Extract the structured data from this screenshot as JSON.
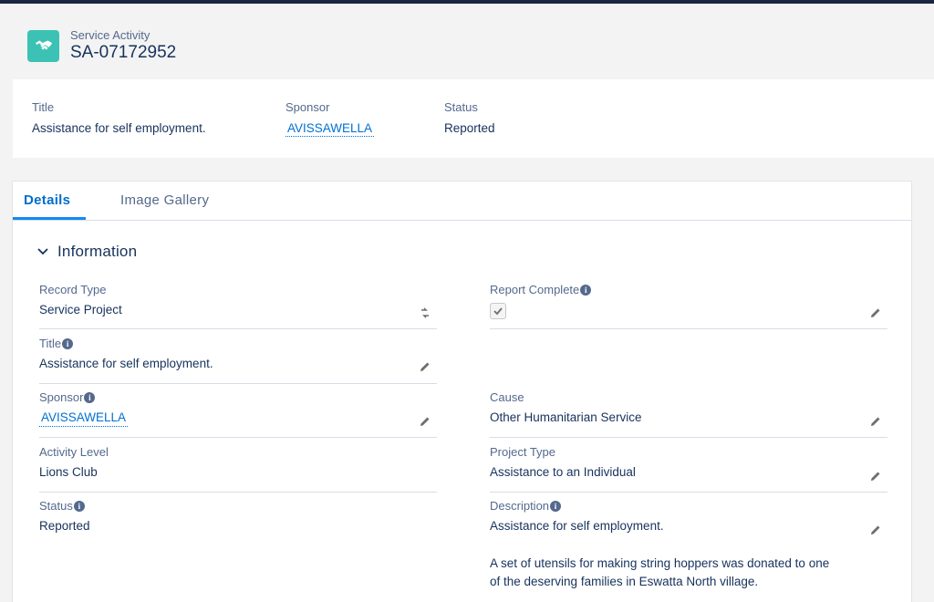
{
  "header": {
    "object_label": "Service Activity",
    "record_name": "SA-07172952",
    "icon": "handshake-icon",
    "icon_color": "#3bc2b4"
  },
  "highlights": {
    "title_label": "Title",
    "title_value": "Assistance for self employment.",
    "sponsor_label": "Sponsor",
    "sponsor_value": "AVISSAWELLA",
    "status_label": "Status",
    "status_value": "Reported"
  },
  "tabs": {
    "details": "Details",
    "gallery": "Image Gallery"
  },
  "section": {
    "title": "Information"
  },
  "fields": {
    "record_type": {
      "label": "Record Type",
      "value": "Service Project"
    },
    "title": {
      "label": "Title",
      "value": "Assistance for self employment."
    },
    "sponsor": {
      "label": "Sponsor",
      "value": "AVISSAWELLA"
    },
    "activity_level": {
      "label": "Activity Level",
      "value": "Lions Club"
    },
    "status": {
      "label": "Status",
      "value": "Reported"
    },
    "report_complete": {
      "label": "Report Complete",
      "checked": true
    },
    "cause": {
      "label": "Cause",
      "value": "Other Humanitarian Service"
    },
    "project_type": {
      "label": "Project Type",
      "value": "Assistance to an Individual"
    },
    "description": {
      "label": "Description",
      "line1": "Assistance for self employment.",
      "line2": "A set of utensils for making string hoppers was donated to one",
      "line3": "of the deserving families in Eswatta North village."
    }
  },
  "info_glyph": "i",
  "colors": {
    "accent": "#0070d2",
    "tab_underline": "#1589ee",
    "topbar": "#1b2640"
  }
}
